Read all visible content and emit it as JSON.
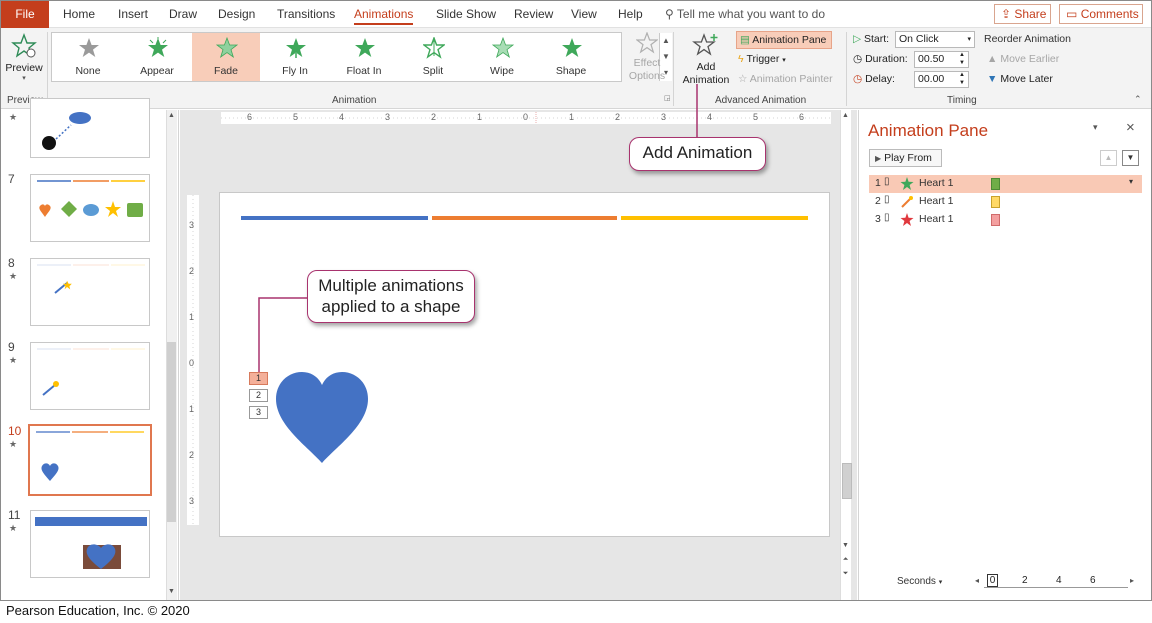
{
  "tabs": {
    "file": "File",
    "items": [
      "Home",
      "Insert",
      "Draw",
      "Design",
      "Transitions",
      "Animations",
      "Slide Show",
      "Review",
      "View",
      "Help"
    ],
    "active": "Animations",
    "tell_me": "Tell me what you want to do",
    "share": "Share",
    "comments": "Comments"
  },
  "ribbon": {
    "preview": {
      "label": "Preview",
      "group": "Preview"
    },
    "animation_gallery": {
      "group": "Animation",
      "items": [
        {
          "label": "None",
          "icon": "star-gray-icon"
        },
        {
          "label": "Appear",
          "icon": "star-green-burst-icon"
        },
        {
          "label": "Fade",
          "icon": "star-fade-icon",
          "selected": true
        },
        {
          "label": "Fly In",
          "icon": "star-flyin-icon"
        },
        {
          "label": "Float In",
          "icon": "star-floatin-icon"
        },
        {
          "label": "Split",
          "icon": "star-split-icon"
        },
        {
          "label": "Wipe",
          "icon": "star-wipe-icon"
        },
        {
          "label": "Shape",
          "icon": "star-shape-icon"
        }
      ],
      "effect_options": "Effect Options"
    },
    "advanced": {
      "group": "Advanced Animation",
      "add_animation": "Add Animation",
      "animation_pane": "Animation Pane",
      "trigger": "Trigger",
      "animation_painter": "Animation Painter"
    },
    "timing": {
      "group": "Timing",
      "start_label": "Start:",
      "start_value": "On Click",
      "duration_label": "Duration:",
      "duration_value": "00.50",
      "delay_label": "Delay:",
      "delay_value": "00.00",
      "reorder_label": "Reorder Animation",
      "move_earlier": "Move Earlier",
      "move_later": "Move Later"
    }
  },
  "thumbnails": [
    {
      "num": "7",
      "star": false
    },
    {
      "num": "8",
      "star": true
    },
    {
      "num": "9",
      "star": true
    },
    {
      "num": "10",
      "star": true,
      "active": true
    },
    {
      "num": "11",
      "star": true
    }
  ],
  "rulers": {
    "horizontal": [
      "6",
      "5",
      "4",
      "3",
      "2",
      "1",
      "0",
      "1",
      "2",
      "3",
      "4",
      "5",
      "6"
    ],
    "vertical": [
      "3",
      "2",
      "1",
      "0",
      "1",
      "2",
      "3"
    ]
  },
  "slide": {
    "animation_tags": [
      "1",
      "2",
      "3"
    ],
    "bar_colors": [
      "#4472c4",
      "#ed7d31",
      "#ffc000"
    ],
    "heart_color": "#4472c4"
  },
  "callouts": {
    "add_animation": "Add Animation",
    "multiple_line1": "Multiple animations",
    "multiple_line2": "applied to a shape"
  },
  "animation_pane": {
    "title": "Animation Pane",
    "play_from": "Play From",
    "rows": [
      {
        "num": "1",
        "name": "Heart 1",
        "effect_icon": "burst-effect-icon",
        "bar_color": "#70ad47"
      },
      {
        "num": "2",
        "name": "Heart 1",
        "effect_icon": "motion-effect-icon",
        "bar_color": "#ffd966"
      },
      {
        "num": "3",
        "name": "Heart 1",
        "effect_icon": "exit-star-icon",
        "bar_color": "#f4a0a0"
      }
    ],
    "seconds_label": "Seconds",
    "timeline": [
      "0",
      "2",
      "4",
      "6"
    ]
  },
  "credit": "Pearson Education, Inc. © 2020"
}
